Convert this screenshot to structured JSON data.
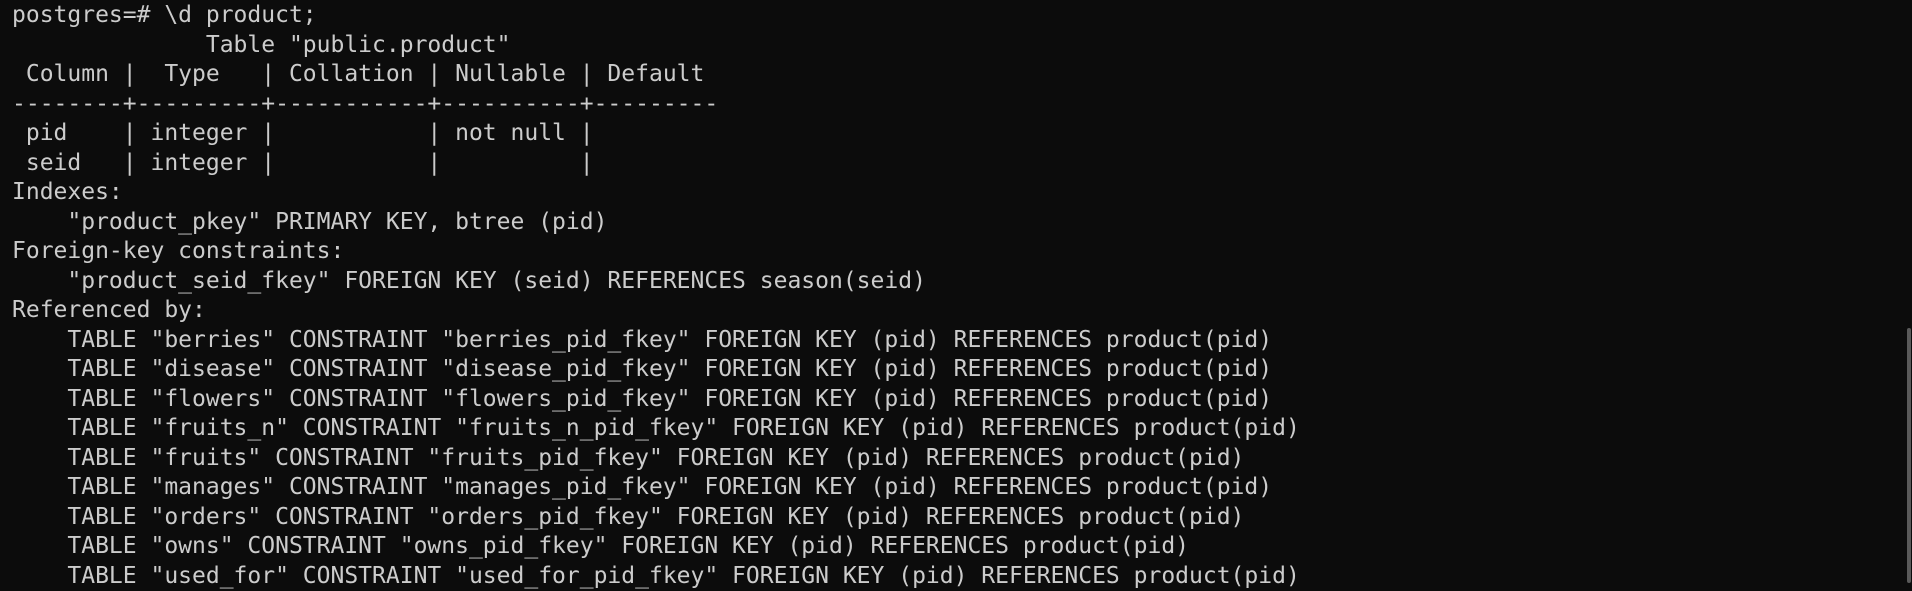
{
  "terminal": {
    "prompt_line": "postgres=# \\d product;",
    "table_title": "              Table \"public.product\"",
    "columns_header": " Column |  Type   | Collation | Nullable | Default",
    "separator": "--------+---------+-----------+----------+---------",
    "rows": [
      " pid    | integer |           | not null |",
      " seid   | integer |           |          |"
    ],
    "indexes_heading": "Indexes:",
    "indexes": [
      "    \"product_pkey\" PRIMARY KEY, btree (pid)"
    ],
    "fk_heading": "Foreign-key constraints:",
    "foreign_keys": [
      "    \"product_seid_fkey\" FOREIGN KEY (seid) REFERENCES season(seid)"
    ],
    "referenced_heading": "Referenced by:",
    "referenced_by": [
      "    TABLE \"berries\" CONSTRAINT \"berries_pid_fkey\" FOREIGN KEY (pid) REFERENCES product(pid)",
      "    TABLE \"disease\" CONSTRAINT \"disease_pid_fkey\" FOREIGN KEY (pid) REFERENCES product(pid)",
      "    TABLE \"flowers\" CONSTRAINT \"flowers_pid_fkey\" FOREIGN KEY (pid) REFERENCES product(pid)",
      "    TABLE \"fruits_n\" CONSTRAINT \"fruits_n_pid_fkey\" FOREIGN KEY (pid) REFERENCES product(pid)",
      "    TABLE \"fruits\" CONSTRAINT \"fruits_pid_fkey\" FOREIGN KEY (pid) REFERENCES product(pid)",
      "    TABLE \"manages\" CONSTRAINT \"manages_pid_fkey\" FOREIGN KEY (pid) REFERENCES product(pid)",
      "    TABLE \"orders\" CONSTRAINT \"orders_pid_fkey\" FOREIGN KEY (pid) REFERENCES product(pid)",
      "    TABLE \"owns\" CONSTRAINT \"owns_pid_fkey\" FOREIGN KEY (pid) REFERENCES product(pid)",
      "    TABLE \"used_for\" CONSTRAINT \"used_for_pid_fkey\" FOREIGN KEY (pid) REFERENCES product(pid)"
    ]
  },
  "colors": {
    "background": "#0c0c0c",
    "text": "#cccccc"
  }
}
